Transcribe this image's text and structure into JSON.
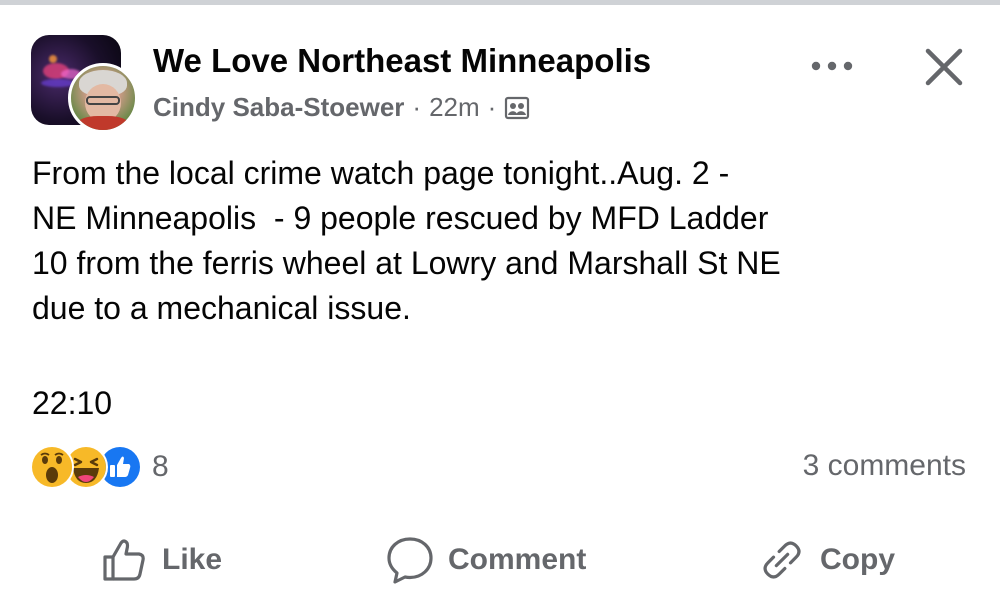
{
  "post": {
    "group_name": "We Love Northeast Minneapolis",
    "author": "Cindy Saba-Stoewer",
    "separator": "·",
    "time_ago": "22m",
    "audience_icon": "group-members-icon",
    "body": "From the local crime watch page tonight..Aug. 2 -\nNE Minneapolis  - 9 people rescued by MFD Ladder\n10 from the ferris wheel at Lowry and Marshall St NE\ndue to a mechanical issue.",
    "time_stamp": "22:10"
  },
  "header": {
    "more_icon": "more-horizontal-icon",
    "close_icon": "close-icon"
  },
  "reactions": {
    "types": [
      "wow",
      "haha",
      "like"
    ],
    "count": "8",
    "comments": "3 comments"
  },
  "actions": {
    "like_label": "Like",
    "comment_label": "Comment",
    "copy_label": "Copy"
  },
  "colors": {
    "text_primary": "#050505",
    "text_secondary": "#65676b",
    "like_blue": "#1877f2",
    "reaction_yellow": "#f7b928"
  }
}
